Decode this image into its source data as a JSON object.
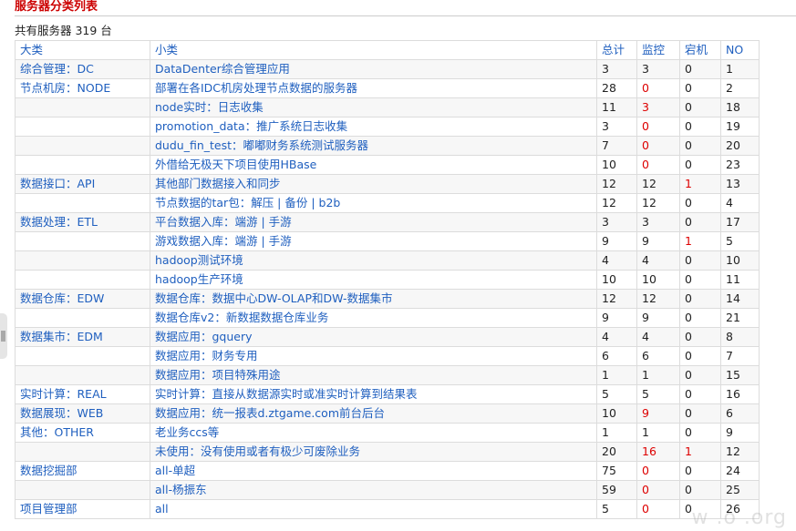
{
  "heading": "服务器分类列表",
  "summary": "共有服务器 319 台",
  "watermark": "w  .o  .org",
  "table": {
    "headers": [
      "大类",
      "小类",
      "总计",
      "监控",
      "宕机",
      "NO"
    ],
    "rows": [
      {
        "category": "综合管理：DC",
        "subcategory": "DataDenter综合管理应用",
        "total": "3",
        "monitor": "3",
        "down": "0",
        "no": "1"
      },
      {
        "category": "节点机房：NODE",
        "subcategory": "部署在各IDC机房处理节点数据的服务器",
        "total": "28",
        "monitor": "0",
        "down": "0",
        "no": "2"
      },
      {
        "category": "",
        "subcategory": "node实时：日志收集",
        "total": "11",
        "monitor": "3",
        "down": "0",
        "no": "18"
      },
      {
        "category": "",
        "subcategory": "promotion_data：推广系统日志收集",
        "total": "3",
        "monitor": "0",
        "down": "0",
        "no": "19"
      },
      {
        "category": "",
        "subcategory": "dudu_fin_test：嘟嘟财务系统测试服务器",
        "total": "7",
        "monitor": "0",
        "down": "0",
        "no": "20"
      },
      {
        "category": "",
        "subcategory": "外借给无极天下项目使用HBase",
        "total": "10",
        "monitor": "0",
        "down": "0",
        "no": "23"
      },
      {
        "category": "数据接口：API",
        "subcategory": "其他部门数据接入和同步",
        "total": "12",
        "monitor": "12",
        "down": "1",
        "no": "13"
      },
      {
        "category": "",
        "subcategory": "节点数据的tar包：解压 | 备份 | b2b",
        "total": "12",
        "monitor": "12",
        "down": "0",
        "no": "4"
      },
      {
        "category": "数据处理：ETL",
        "subcategory": "平台数据入库：端游 | 手游",
        "total": "3",
        "monitor": "3",
        "down": "0",
        "no": "17"
      },
      {
        "category": "",
        "subcategory": "游戏数据入库：端游 | 手游",
        "total": "9",
        "monitor": "9",
        "down": "1",
        "no": "5"
      },
      {
        "category": "",
        "subcategory": "hadoop测试环境",
        "total": "4",
        "monitor": "4",
        "down": "0",
        "no": "10"
      },
      {
        "category": "",
        "subcategory": "hadoop生产环境",
        "total": "10",
        "monitor": "10",
        "down": "0",
        "no": "11"
      },
      {
        "category": "数据仓库：EDW",
        "subcategory": "数据仓库：数据中心DW-OLAP和DW-数据集市",
        "total": "12",
        "monitor": "12",
        "down": "0",
        "no": "14"
      },
      {
        "category": "",
        "subcategory": "数据仓库v2：新数据数据仓库业务",
        "total": "9",
        "monitor": "9",
        "down": "0",
        "no": "21"
      },
      {
        "category": "数据集市：EDM",
        "subcategory": "数据应用：gquery",
        "total": "4",
        "monitor": "4",
        "down": "0",
        "no": "8"
      },
      {
        "category": "",
        "subcategory": "数据应用：财务专用",
        "total": "6",
        "monitor": "6",
        "down": "0",
        "no": "7"
      },
      {
        "category": "",
        "subcategory": "数据应用：项目特殊用途",
        "total": "1",
        "monitor": "1",
        "down": "0",
        "no": "15"
      },
      {
        "category": "实时计算：REAL",
        "subcategory": "实时计算：直接从数据源实时或准实时计算到结果表",
        "total": "5",
        "monitor": "5",
        "down": "0",
        "no": "16"
      },
      {
        "category": "数据展现：WEB",
        "subcategory": "数据应用：统一报表d.ztgame.com前台后台",
        "total": "10",
        "monitor": "9",
        "down": "0",
        "no": "6"
      },
      {
        "category": "其他：OTHER",
        "subcategory": "老业务ccs等",
        "total": "1",
        "monitor": "1",
        "down": "0",
        "no": "9"
      },
      {
        "category": "",
        "subcategory": "未使用：没有使用或者有极少可废除业务",
        "total": "20",
        "monitor": "16",
        "down": "1",
        "no": "12"
      },
      {
        "category": "数据挖掘部",
        "subcategory": "all-单超",
        "total": "75",
        "monitor": "0",
        "down": "0",
        "no": "24"
      },
      {
        "category": "",
        "subcategory": "all-杨振东",
        "total": "59",
        "monitor": "0",
        "down": "0",
        "no": "25"
      },
      {
        "category": "项目管理部",
        "subcategory": "all",
        "total": "5",
        "monitor": "0",
        "down": "0",
        "no": "26"
      }
    ]
  },
  "colors": {
    "heading": "#cc0000",
    "link": "#1f5fbf",
    "alert": "#dd0000",
    "text": "#222222",
    "border": "#dcdcdc"
  }
}
